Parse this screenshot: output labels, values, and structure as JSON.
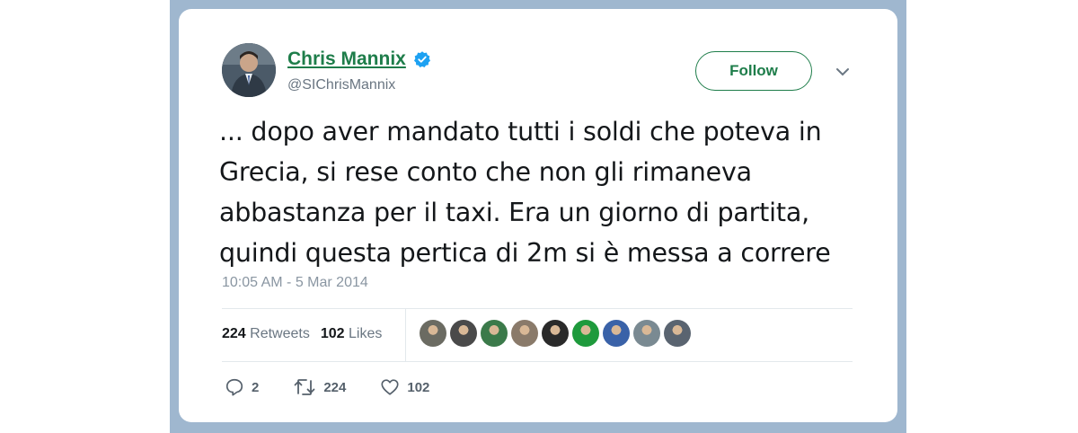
{
  "user": {
    "name": "Chris Mannix",
    "handle": "@SIChrisMannix"
  },
  "follow_label": "Follow",
  "tweet": {
    "lines": [
      "... dopo aver mandato tutti i soldi che poteva in",
      "Grecia, si rese conto che non gli rimaneva",
      "abbastanza per il taxi. Era un giorno di partita,",
      "quindi questa pertica di 2m si è messa a correre"
    ],
    "timestamp": "10:05 AM - 5 Mar 2014"
  },
  "stats": {
    "retweets_count": "224",
    "retweets_label": "Retweets",
    "likes_count": "102",
    "likes_label": "Likes"
  },
  "liker_colors": [
    "#6b6b62",
    "#4a4a4a",
    "#3b7a4a",
    "#8a7a6a",
    "#2a2a2a",
    "#1e9a3c",
    "#3a62a8",
    "#7a8a92",
    "#5a6470"
  ],
  "actions": {
    "replies": "2",
    "retweets": "224",
    "likes": "102"
  },
  "colors": {
    "accent": "#1e7d4a",
    "verified": "#1da1f2",
    "frame": "#9fb7cf"
  },
  "icons": [
    "verified-badge-icon",
    "chevron-down-icon",
    "reply-icon",
    "retweet-icon",
    "heart-icon"
  ]
}
